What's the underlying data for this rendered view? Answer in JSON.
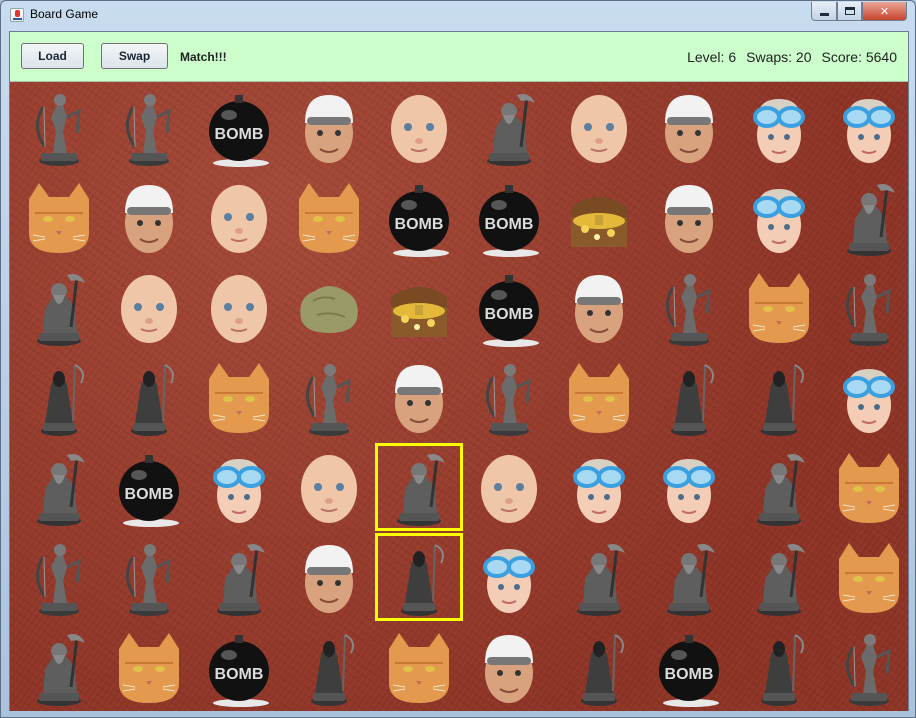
{
  "window": {
    "title": "Board Game",
    "minimize_icon": "minimize-icon",
    "maximize_icon": "maximize-icon",
    "close_icon": "close-icon"
  },
  "toolbar": {
    "load_label": "Load",
    "swap_label": "Swap",
    "message": "Match!!!",
    "level_text": "Level: 6",
    "swaps_text": "Swaps: 20",
    "score_text": "Score: 5640"
  },
  "colors": {
    "toolbar_bg": "#ccffcc",
    "board_bg": "#9b3f30",
    "selection": "#ffff00"
  },
  "board": {
    "rows": [
      [
        "archer",
        "archer",
        "bomb",
        "swimmer-man",
        "baby",
        "dwarf",
        "baby",
        "swimmer-man",
        "goggles-kid",
        "goggles-kid"
      ],
      [
        "cat",
        "swimmer-man",
        "baby",
        "cat",
        "bomb",
        "bomb",
        "treasure",
        "swimmer-man",
        "goggles-kid",
        "dwarf"
      ],
      [
        "dwarf",
        "baby",
        "baby",
        "rock",
        "treasure",
        "bomb",
        "swimmer-man",
        "archer",
        "cat",
        "archer"
      ],
      [
        "reaper",
        "reaper",
        "cat",
        "archer",
        "swimmer-man",
        "archer",
        "cat",
        "reaper",
        "reaper",
        "goggles-kid"
      ],
      [
        "dwarf",
        "bomb",
        "goggles-kid",
        "baby",
        "dwarf",
        "baby",
        "goggles-kid",
        "goggles-kid",
        "dwarf",
        "cat"
      ],
      [
        "archer",
        "archer",
        "dwarf",
        "swimmer-man",
        "reaper",
        "goggles-kid",
        "dwarf",
        "dwarf",
        "dwarf",
        "cat"
      ],
      [
        "dwarf",
        "cat",
        "bomb",
        "reaper",
        "cat",
        "swimmer-man",
        "reaper",
        "bomb",
        "reaper",
        "archer"
      ]
    ],
    "selected": [
      [
        4,
        4
      ],
      [
        5,
        4
      ]
    ]
  },
  "tile_types": {
    "archer": {
      "icon": "archer-miniature-icon"
    },
    "dwarf": {
      "icon": "dwarf-miniature-icon"
    },
    "reaper": {
      "icon": "reaper-miniature-icon"
    },
    "bomb": {
      "icon": "bomb-icon",
      "text": "BOMB"
    },
    "swimmer-man": {
      "icon": "swimmer-man-face-icon"
    },
    "baby": {
      "icon": "baby-face-icon"
    },
    "goggles-kid": {
      "icon": "goggles-kid-face-icon"
    },
    "cat": {
      "icon": "cat-face-icon"
    },
    "treasure": {
      "icon": "treasure-chest-icon"
    },
    "rock": {
      "icon": "rock-icon"
    }
  }
}
